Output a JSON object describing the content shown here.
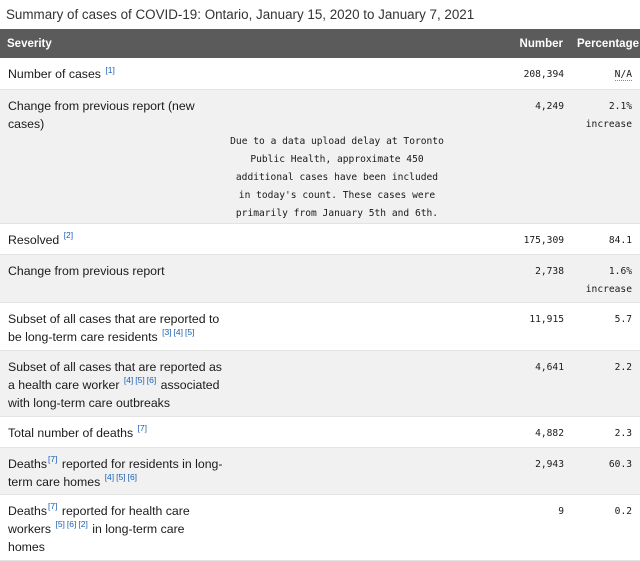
{
  "caption": "Summary of cases of COVID-19: Ontario, January 15, 2020 to January 7, 2021",
  "headers": {
    "severity": "Severity",
    "number": "Number",
    "percentage": "Percentage"
  },
  "rows": [
    {
      "label": "Number of cases",
      "refs": [
        "[1]"
      ],
      "number": "208,394",
      "percent": "N/A"
    },
    {
      "label": "Change from previous report (new cases)",
      "note": "Due to a data upload delay at Toronto Public Health, approximate 450 additional cases have been included in today's count. These cases were primarily from January 5th and 6th.",
      "number": "4,249",
      "percent": "2.1%",
      "percent_note": "increase"
    },
    {
      "label": "Resolved",
      "refs": [
        "[2]"
      ],
      "number": "175,309",
      "percent": "84.1"
    },
    {
      "label": "Change from previous report",
      "number": "2,738",
      "percent": "1.6%",
      "percent_note": "increase"
    },
    {
      "label": "Subset of all cases that are reported to be long-term care residents",
      "refs": [
        "[3]",
        "[4]",
        "[5]"
      ],
      "number": "11,915",
      "percent": "5.7"
    },
    {
      "label_a": "Subset of all cases that are reported as a health care worker",
      "refs": [
        "[4]",
        "[5]",
        "[6]"
      ],
      "label_b": "associated with long-term care outbreaks",
      "number": "4,641",
      "percent": "2.2"
    },
    {
      "label": "Total number of deaths",
      "refs": [
        "[7]"
      ],
      "number": "4,882",
      "percent": "2.3"
    },
    {
      "label_a": "Deaths",
      "refs_a": [
        "[7]"
      ],
      "label_b": "reported for residents in long-term care homes",
      "refs_b": [
        "[4]",
        "[5]",
        "[6]"
      ],
      "number": "2,943",
      "percent": "60.3"
    },
    {
      "label_a": "Deaths",
      "refs_a": [
        "[7]"
      ],
      "label_b": "reported for health care workers",
      "refs_b": [
        "[5]",
        "[6]",
        "[2]"
      ],
      "label_c": "in long-term care homes",
      "number": "9",
      "percent": "0.2"
    }
  ]
}
